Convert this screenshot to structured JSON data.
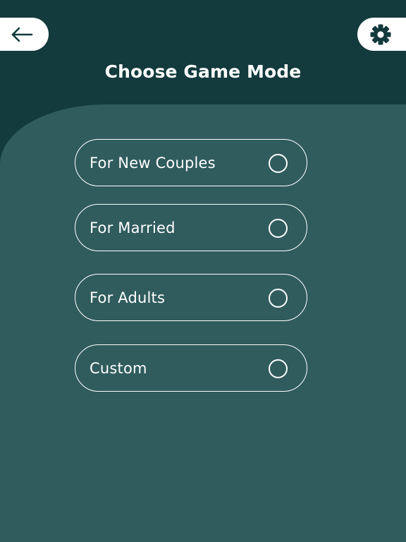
{
  "header": {
    "title": "Choose Game Mode",
    "back_icon": "arrow-left-icon",
    "settings_icon": "gear-icon"
  },
  "modes": [
    {
      "label": "For New Couples",
      "selected": false
    },
    {
      "label": "For Married",
      "selected": false
    },
    {
      "label": "For Adults",
      "selected": false
    },
    {
      "label": "Custom",
      "selected": false
    }
  ],
  "colors": {
    "header_background": "#133a3c",
    "panel_background": "#305c5e",
    "text": "#ffffff",
    "button_background": "#ffffff"
  }
}
